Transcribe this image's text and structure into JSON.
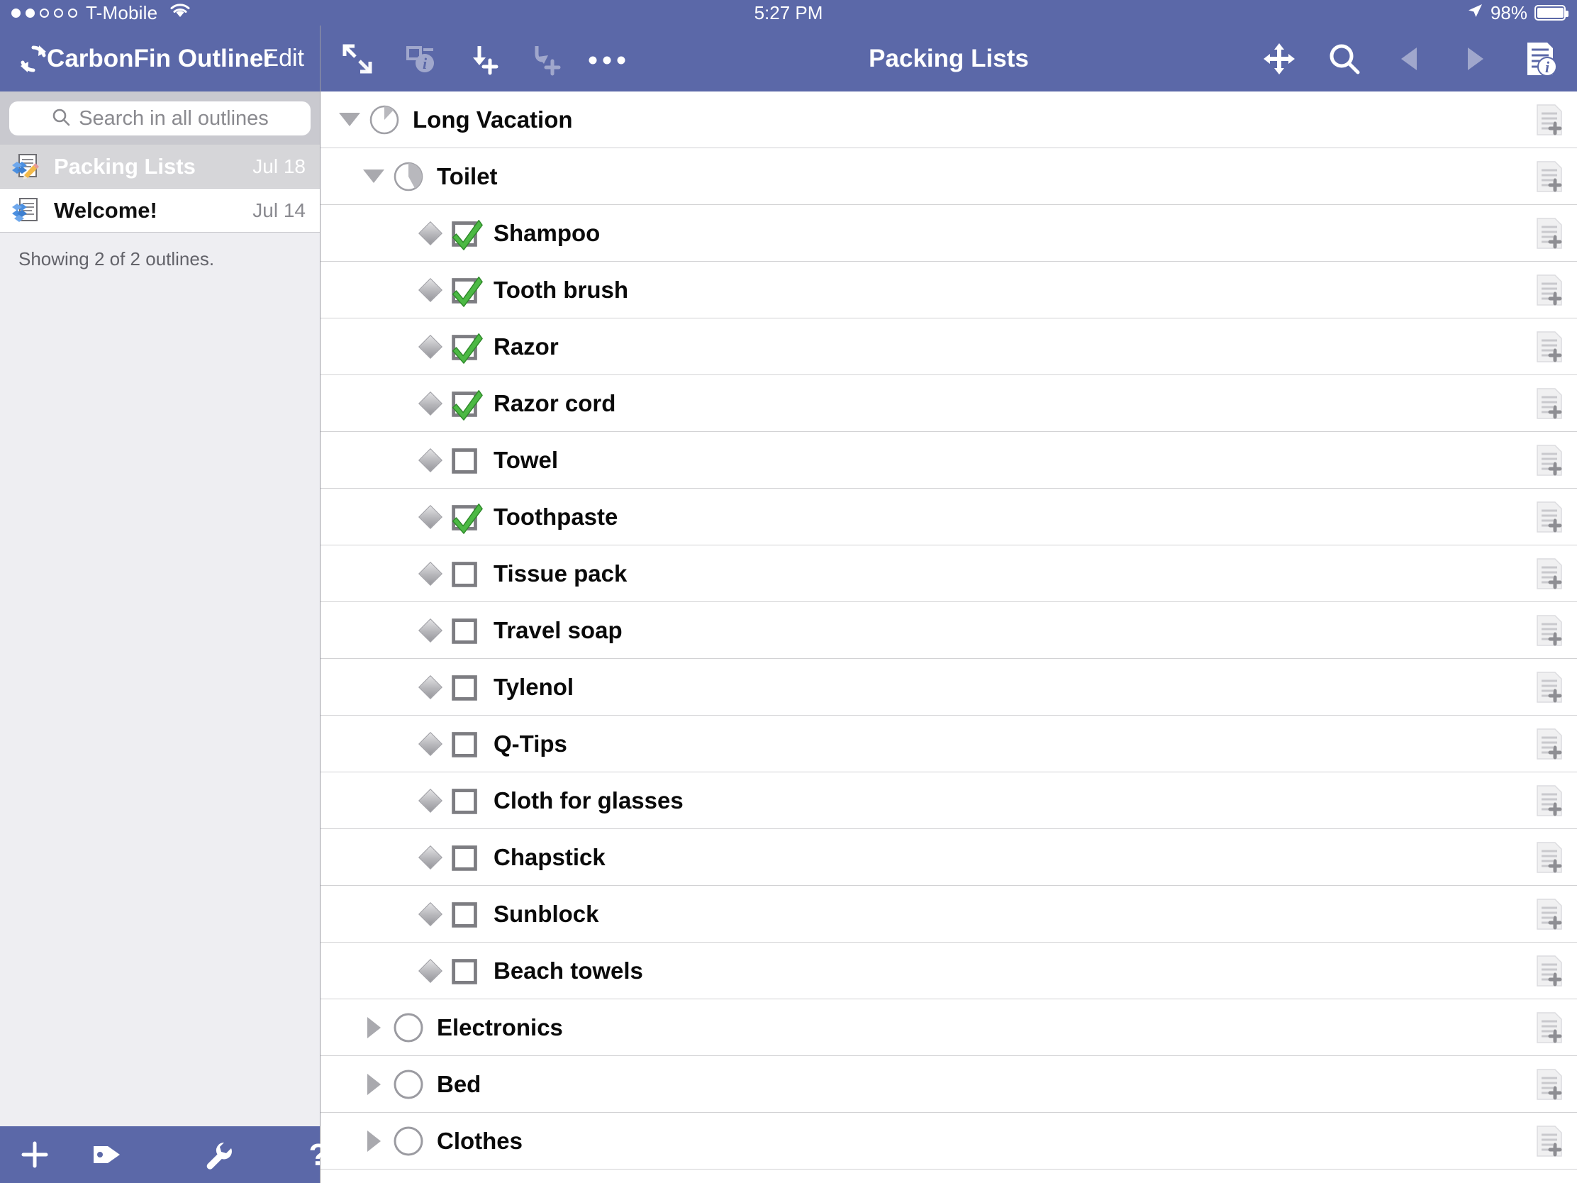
{
  "status_bar": {
    "carrier": "T-Mobile",
    "signal_dots_filled": 2,
    "signal_dots_total": 5,
    "time": "5:27 PM",
    "battery_percent": "98%",
    "battery_level": 98,
    "wifi_icon": "wifi-icon",
    "location_icon": "location-arrow-icon"
  },
  "sidebar": {
    "sync_icon": "sync-refresh-icon",
    "title": "CarbonFin Outliner",
    "edit_label": "Edit",
    "search": {
      "placeholder": "Search in all outlines",
      "value": "",
      "icon": "search-icon"
    },
    "outlines": [
      {
        "name": "Packing Lists",
        "date": "Jul 18",
        "icon": "dropbox-document-icon",
        "selected": true
      },
      {
        "name": "Welcome!",
        "date": "Jul 14",
        "icon": "dropbox-stack-icon",
        "selected": false
      }
    ],
    "status_text": "Showing 2 of 2 outlines.",
    "footer": {
      "add_label": "+",
      "add_icon": "plus-icon",
      "tag_icon": "tag-icon",
      "wrench_icon": "wrench-icon",
      "help_icon": "question-mark-icon"
    }
  },
  "main": {
    "title": "Packing Lists",
    "toolbar_left": [
      {
        "name": "expand-collapse-icon",
        "enabled": true
      },
      {
        "name": "note-info-icon",
        "enabled": false
      },
      {
        "name": "add-sibling-icon",
        "enabled": true
      },
      {
        "name": "add-child-icon",
        "enabled": false
      },
      {
        "name": "more-options-icon",
        "enabled": true
      }
    ],
    "toolbar_right": [
      {
        "name": "move-icon",
        "enabled": true
      },
      {
        "name": "search-icon",
        "enabled": true
      },
      {
        "name": "back-icon",
        "enabled": false
      },
      {
        "name": "forward-icon",
        "enabled": false
      },
      {
        "name": "document-info-icon",
        "enabled": true
      }
    ],
    "note_icon": "add-note-icon",
    "nodes": [
      {
        "label": "Long Vacation",
        "depth": 0,
        "disclosure": "down",
        "marker": "pie",
        "pie_fill": 0.12,
        "note": true
      },
      {
        "label": "Toilet",
        "depth": 1,
        "disclosure": "down",
        "marker": "pie",
        "pie_fill": 0.42,
        "note": true
      },
      {
        "label": "Shampoo",
        "depth": 2,
        "disclosure": "none",
        "marker": "checkbox",
        "checked": true,
        "note": true
      },
      {
        "label": "Tooth brush",
        "depth": 2,
        "disclosure": "none",
        "marker": "checkbox",
        "checked": true,
        "note": true
      },
      {
        "label": "Razor",
        "depth": 2,
        "disclosure": "none",
        "marker": "checkbox",
        "checked": true,
        "note": true
      },
      {
        "label": "Razor cord",
        "depth": 2,
        "disclosure": "none",
        "marker": "checkbox",
        "checked": true,
        "note": true
      },
      {
        "label": "Towel",
        "depth": 2,
        "disclosure": "none",
        "marker": "checkbox",
        "checked": false,
        "note": true
      },
      {
        "label": "Toothpaste",
        "depth": 2,
        "disclosure": "none",
        "marker": "checkbox",
        "checked": true,
        "note": true
      },
      {
        "label": "Tissue pack",
        "depth": 2,
        "disclosure": "none",
        "marker": "checkbox",
        "checked": false,
        "note": true
      },
      {
        "label": "Travel soap",
        "depth": 2,
        "disclosure": "none",
        "marker": "checkbox",
        "checked": false,
        "note": true
      },
      {
        "label": "Tylenol",
        "depth": 2,
        "disclosure": "none",
        "marker": "checkbox",
        "checked": false,
        "note": true
      },
      {
        "label": "Q-Tips",
        "depth": 2,
        "disclosure": "none",
        "marker": "checkbox",
        "checked": false,
        "note": true
      },
      {
        "label": "Cloth for glasses",
        "depth": 2,
        "disclosure": "none",
        "marker": "checkbox",
        "checked": false,
        "note": true
      },
      {
        "label": "Chapstick",
        "depth": 2,
        "disclosure": "none",
        "marker": "checkbox",
        "checked": false,
        "note": true
      },
      {
        "label": "Sunblock",
        "depth": 2,
        "disclosure": "none",
        "marker": "checkbox",
        "checked": false,
        "note": true
      },
      {
        "label": "Beach towels",
        "depth": 2,
        "disclosure": "none",
        "marker": "checkbox",
        "checked": false,
        "note": true
      },
      {
        "label": "Electronics",
        "depth": 1,
        "disclosure": "right",
        "marker": "circle",
        "note": true
      },
      {
        "label": "Bed",
        "depth": 1,
        "disclosure": "right",
        "marker": "circle",
        "note": true
      },
      {
        "label": "Clothes",
        "depth": 1,
        "disclosure": "right",
        "marker": "circle",
        "note": true
      }
    ]
  },
  "colors": {
    "chrome_blue": "#5b68a8",
    "sidebar_bg": "#eeeef2",
    "selected_row": "#d6d6d9",
    "check_green": "#4cb944",
    "separator": "#d2d2d4"
  }
}
